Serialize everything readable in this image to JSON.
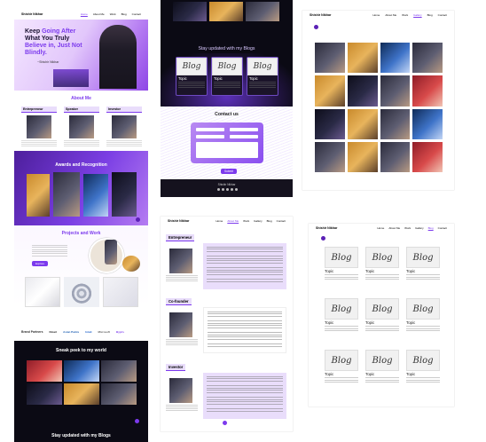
{
  "panel1": {
    "nav_logo": "Shishir Nikhar",
    "nav_links": [
      "Home",
      "About Me",
      "Work",
      "Blog",
      "Contact"
    ],
    "hero_line1a": "Keep ",
    "hero_line1b": "Going After",
    "hero_line2": "What You Truly",
    "hero_line3": "Believe in, Just Not",
    "hero_line4": "Blindly.",
    "hero_attrib": "~Shishir Nikhar",
    "about_title": "About Me",
    "roles": [
      "Entrepreneur",
      "Speaker",
      "Investor"
    ],
    "awards_title": "Awards and Recognition",
    "projects_title": "Projects and Work",
    "projects_btn": "Explore",
    "partners_label": "Brand Partners",
    "partners": [
      "Dmart",
      "Asian Paints",
      "Intuit",
      "Microsoft",
      "Byju's"
    ],
    "sneak_title": "Sneak peek to my world",
    "blogs_title": "Stay updated with my Blogs"
  },
  "panel2": {
    "blogs_title": "Stay updated with my Blogs",
    "blog_cards": [
      {
        "img_text": "Blog",
        "topic": "Topic"
      },
      {
        "img_text": "Blog",
        "topic": "Topic"
      },
      {
        "img_text": "Blog",
        "topic": "Topic"
      }
    ],
    "contact_title": "Contact us",
    "submit_label": "Submit",
    "footer_logo": "Shishir Nikhar"
  },
  "panel3": {
    "nav_logo": "Shishir Nikhar",
    "nav_links": [
      "Home",
      "About Me",
      "Work",
      "Gallery",
      "Blog",
      "Contact"
    ],
    "active": "Gallery"
  },
  "panel4": {
    "nav_logo": "Shishir Nikhar",
    "nav_links": [
      "Home",
      "About Me",
      "Work",
      "Gallery",
      "Blog",
      "Contact"
    ],
    "sections": [
      {
        "role": "Entrepreneur"
      },
      {
        "role": "Co-founder"
      },
      {
        "role": "Investor"
      }
    ]
  },
  "panel5": {
    "nav_logo": "Shishir Nikhar",
    "nav_links": [
      "Home",
      "About Me",
      "Work",
      "Gallery",
      "Blog",
      "Contact"
    ],
    "active": "Blog",
    "card_img_text": "Blog",
    "card_topic": "Topic"
  },
  "colors": {
    "accent": "#7c3aed",
    "dark": "#0b0a14",
    "lavender": "#e9ddfb"
  }
}
